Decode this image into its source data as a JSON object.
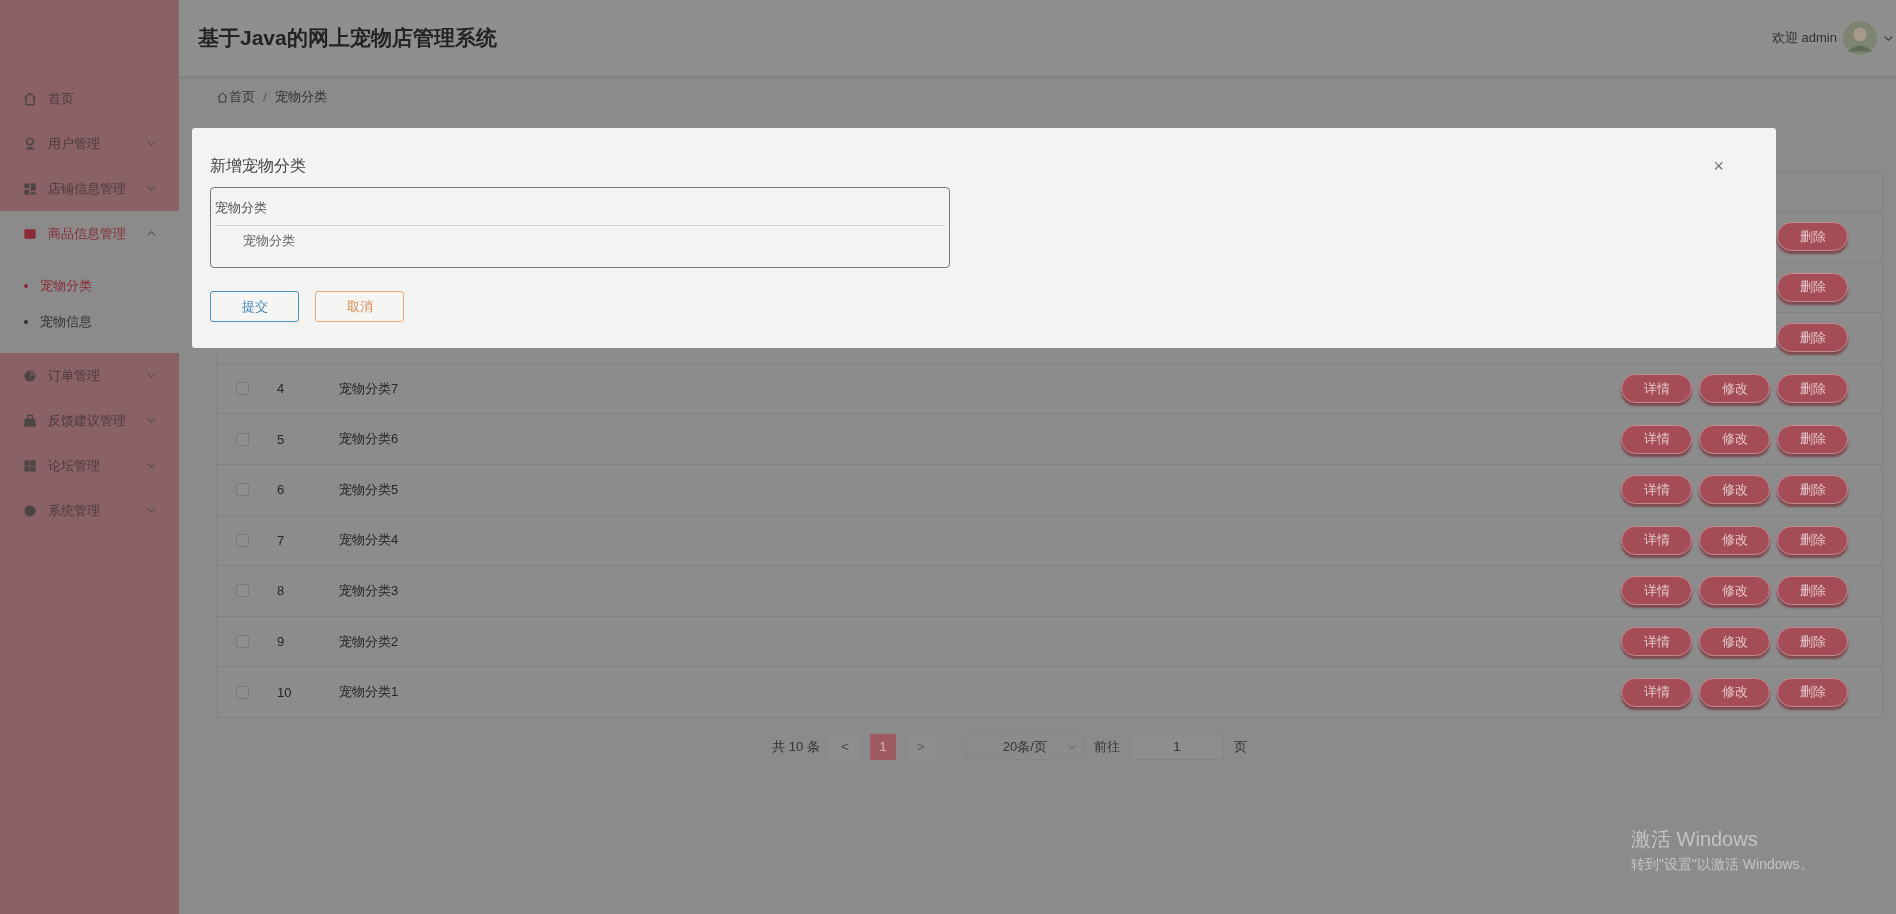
{
  "header": {
    "title": "基于Java的网上宠物店管理系统",
    "welcome": "欢迎 admin"
  },
  "sidebar": {
    "items": [
      {
        "label": "首页"
      },
      {
        "label": "用户管理",
        "expanded": false
      },
      {
        "label": "店铺信息管理",
        "expanded": false
      },
      {
        "label": "商品信息管理",
        "expanded": true,
        "children": [
          {
            "label": "宠物分类",
            "selected": true
          },
          {
            "label": "宠物信息",
            "selected": false
          }
        ]
      },
      {
        "label": "订单管理",
        "expanded": false
      },
      {
        "label": "反馈建议管理",
        "expanded": false
      },
      {
        "label": "论坛管理",
        "expanded": false
      },
      {
        "label": "系统管理",
        "expanded": false
      }
    ]
  },
  "breadcrumb": {
    "separator": "/",
    "items": [
      {
        "label": "首页"
      },
      {
        "label": "宠物分类"
      }
    ]
  },
  "table": {
    "rows": [
      {
        "actions": [
          "删除"
        ]
      },
      {
        "actions": [
          "删除"
        ]
      },
      {
        "actions": [
          "删除"
        ]
      },
      {
        "checked": false,
        "index": "4",
        "name": "宠物分类7",
        "actions": [
          "详情",
          "修改",
          "删除"
        ]
      },
      {
        "checked": false,
        "index": "5",
        "name": "宠物分类6",
        "actions": [
          "详情",
          "修改",
          "删除"
        ]
      },
      {
        "checked": false,
        "index": "6",
        "name": "宠物分类5",
        "actions": [
          "详情",
          "修改",
          "删除"
        ]
      },
      {
        "checked": false,
        "index": "7",
        "name": "宠物分类4",
        "actions": [
          "详情",
          "修改",
          "删除"
        ]
      },
      {
        "checked": false,
        "index": "8",
        "name": "宠物分类3",
        "actions": [
          "详情",
          "修改",
          "删除"
        ]
      },
      {
        "checked": false,
        "index": "9",
        "name": "宠物分类2",
        "actions": [
          "详情",
          "修改",
          "删除"
        ]
      },
      {
        "checked": false,
        "index": "10",
        "name": "宠物分类1",
        "actions": [
          "详情",
          "修改",
          "删除"
        ]
      }
    ]
  },
  "pagination": {
    "total": "共 10 条",
    "prev": "<",
    "pages": [
      {
        "label": "1",
        "selected": true
      }
    ],
    "next": ">",
    "page_size": "20条/页",
    "goto_label": "前往",
    "goto_value": "1",
    "page_unit": "页"
  },
  "dialog": {
    "title": "新增宠物分类",
    "close": "×",
    "section_title": "宠物分类",
    "field_label": "宠物分类",
    "buttons": [
      {
        "label": "提交",
        "kind": "primary"
      },
      {
        "label": "取消",
        "kind": "cancel"
      }
    ]
  },
  "os_notice": {
    "title": "激活 Windows",
    "message": "转到\"设置\"以激活 Windows。"
  }
}
